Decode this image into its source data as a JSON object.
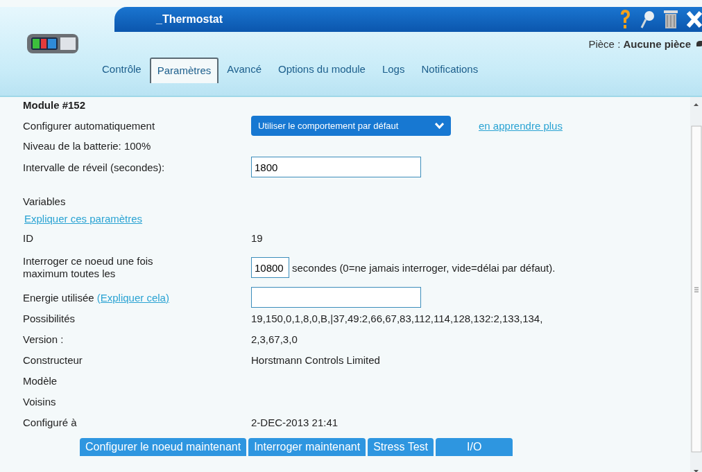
{
  "window": {
    "title": "_Thermostat"
  },
  "room": {
    "label": "Pièce :",
    "value": "Aucune pièce"
  },
  "tabs": [
    {
      "label": "Contrôle",
      "selected": false
    },
    {
      "label": "Paramètres",
      "selected": true
    },
    {
      "label": "Avancé",
      "selected": false
    },
    {
      "label": "Options du module",
      "selected": false
    },
    {
      "label": "Logs",
      "selected": false
    },
    {
      "label": "Notifications",
      "selected": false
    }
  ],
  "module_title": "Module #152",
  "auto_config": {
    "label": "Configurer automatiquement",
    "dropdown": "Utiliser le comportement par défaut",
    "link": "en apprendre plus"
  },
  "battery": "Niveau de la batterie: 100%",
  "wakeup": {
    "label": "Intervalle de réveil (secondes):",
    "value": "1800"
  },
  "variables_title": "Variables",
  "explain_link": "Expliquer ces paramètres",
  "rows": [
    {
      "kind": "text",
      "label": "ID",
      "value": "19"
    },
    {
      "kind": "poll",
      "label": "Interroger ce noeud une fois maximum toutes les",
      "value": "10800",
      "note": "secondes (0=ne jamais interroger, vide=délai par défaut)."
    },
    {
      "kind": "energy",
      "label": "Energie utilisée",
      "link": "(Expliquer cela)"
    },
    {
      "kind": "text",
      "label": "Possibilités",
      "value": "19,150,0,1,8,0,B,|37,49:2,66,67,83,112,114,128,132:2,133,134,"
    },
    {
      "kind": "text",
      "label": "Version :",
      "value": "2,3,67,3,0"
    },
    {
      "kind": "text",
      "label": "Constructeur",
      "value": "Horstmann Controls Limited"
    },
    {
      "kind": "text",
      "label": "Modèle"
    },
    {
      "kind": "text",
      "label": "Voisins"
    },
    {
      "kind": "text",
      "label": "Configuré à",
      "value": "2-DEC-2013 21:41"
    }
  ],
  "buttons": [
    "Configurer le noeud maintenant",
    "Interroger maintenant",
    "Stress Test",
    "I/O"
  ]
}
